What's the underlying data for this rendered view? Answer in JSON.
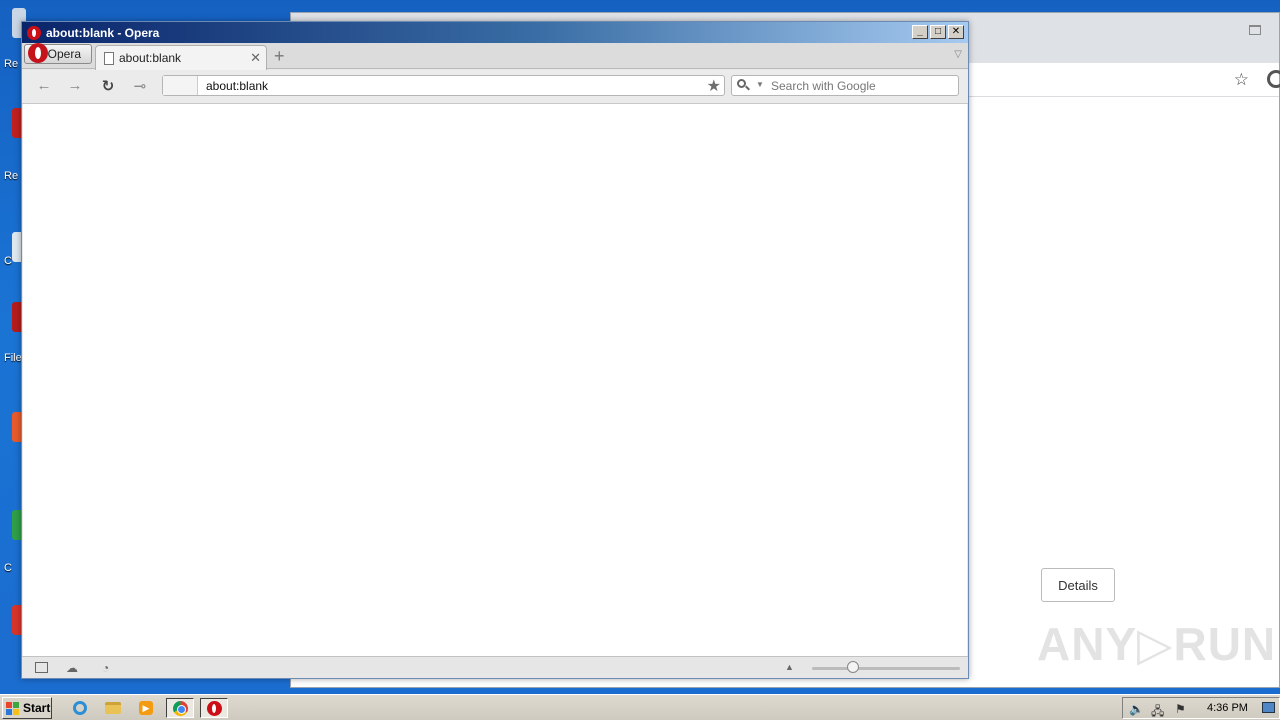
{
  "opera": {
    "window_title": "about:blank - Opera",
    "menu_label": "Opera",
    "tab_label": "about:blank",
    "address_value": "about:blank",
    "search_placeholder": "Search with Google",
    "window_controls": {
      "minimize": "_",
      "maximize": "□",
      "close": "✕"
    },
    "nav_icons": {
      "back": "←",
      "forward": "→",
      "reload": "↻",
      "key": "⊸"
    }
  },
  "background_window": {
    "details_button": "Details",
    "watermark": "ANY▷RUN"
  },
  "taskbar": {
    "start_label": "Start",
    "clock": "4:36 PM",
    "items": [
      "internet-explorer",
      "file-explorer",
      "media-player",
      "chrome",
      "opera"
    ]
  },
  "desktop": {
    "labels": [
      "Re",
      "Re",
      "C",
      "File",
      "C"
    ]
  },
  "colors": {
    "opera_red": "#cc0f16",
    "titlebar_dark": "#0a246a",
    "desktop_blue": "#1a6ed4"
  }
}
